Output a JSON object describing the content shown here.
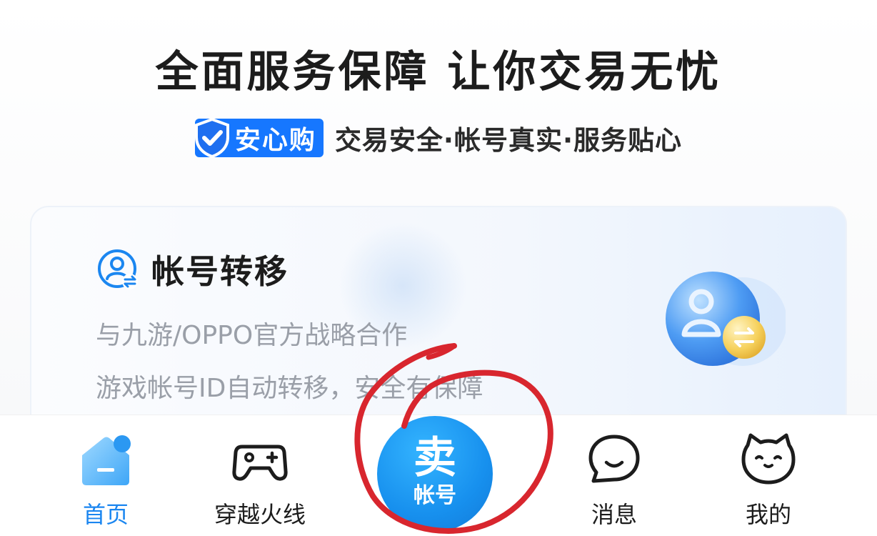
{
  "header": {
    "headline": "全面服务保障   让你交易无忧",
    "badge_label": "安心购",
    "features": "交易安全·帐号真实·服务贴心"
  },
  "card": {
    "title": "帐号转移",
    "line1": "与九游/OPPO官方战略合作",
    "line2": "游戏帐号ID自动转移，安全有保障"
  },
  "bottom_nav": {
    "items": [
      {
        "label": "首页",
        "icon": "home-icon",
        "active": true
      },
      {
        "label": "穿越火线",
        "icon": "gamepad-icon",
        "active": false
      },
      {
        "label": "消息",
        "icon": "chat-bubble-icon",
        "active": false
      },
      {
        "label": "我的",
        "icon": "cat-profile-icon",
        "active": false
      }
    ],
    "sell": {
      "big": "卖",
      "small": "帐号"
    }
  },
  "colors": {
    "accent": "#1b86f0",
    "badge": "#1677ff",
    "annotation": "#d8262e"
  }
}
